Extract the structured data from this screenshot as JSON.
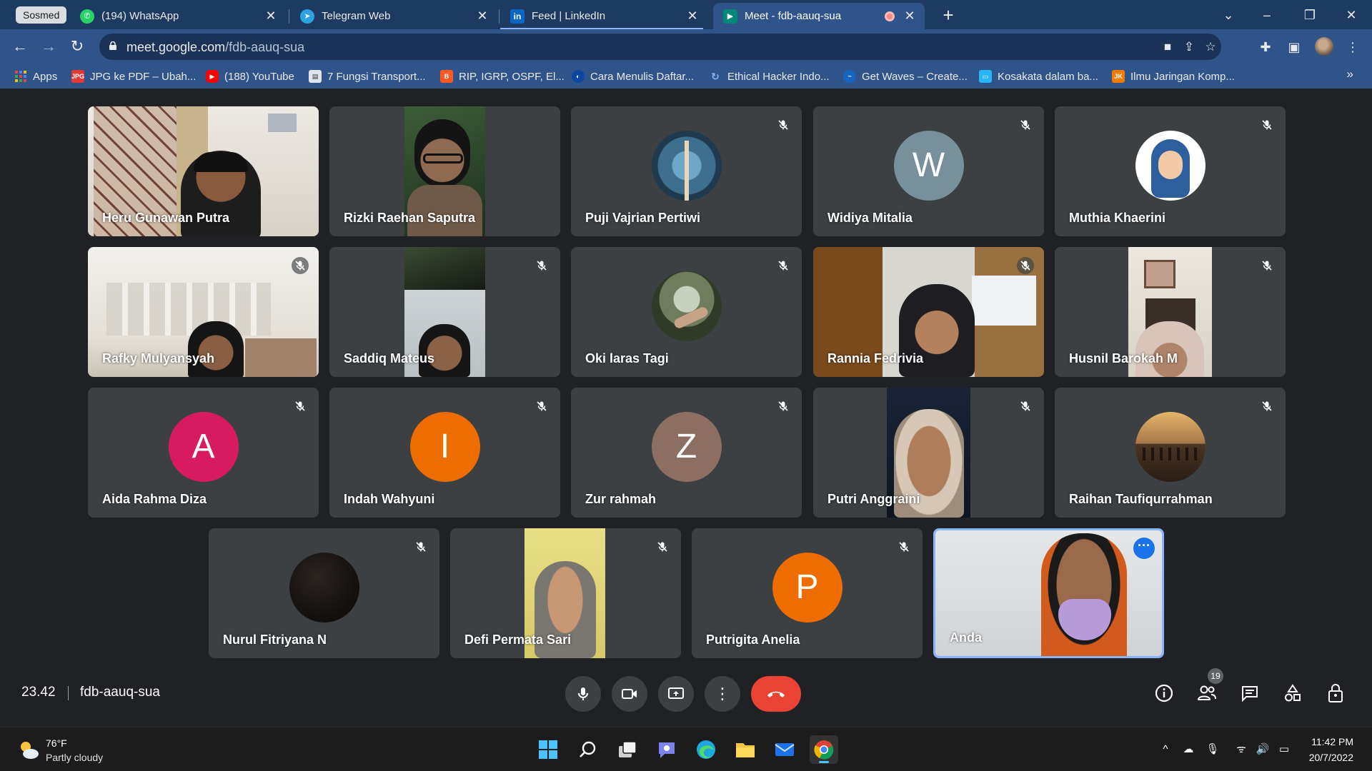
{
  "browser": {
    "tab_group_label": "Sosmed",
    "tabs": [
      {
        "title": "(194) WhatsApp",
        "favicon": "whatsapp-icon",
        "favicon_badge": "194"
      },
      {
        "title": "Telegram Web",
        "favicon": "telegram-icon"
      },
      {
        "title": "Feed | LinkedIn",
        "favicon": "linkedin-icon"
      },
      {
        "title": "Meet - fdb-aauq-sua",
        "favicon": "google-meet-icon",
        "active": true,
        "recording": true
      }
    ],
    "url_host": "meet.google.com",
    "url_path": "/fdb-aauq-sua",
    "bookmarks": [
      {
        "label": "Apps",
        "icon": "apps-grid-icon"
      },
      {
        "label": "JPG ke PDF – Ubah...",
        "icon": "jpg-pdf-icon"
      },
      {
        "label": "(188) YouTube",
        "icon": "youtube-icon"
      },
      {
        "label": "7 Fungsi Transport...",
        "icon": "page-icon"
      },
      {
        "label": "RIP, IGRP, OSPF, El...",
        "icon": "blogger-icon"
      },
      {
        "label": "Cara Menulis Daftar...",
        "icon": "globe-icon"
      },
      {
        "label": "Ethical Hacker Indo...",
        "icon": "link-icon"
      },
      {
        "label": "Get Waves – Create...",
        "icon": "waves-icon"
      },
      {
        "label": "Kosakata dalam ba...",
        "icon": "chat-icon"
      },
      {
        "label": "Ilmu Jaringan Komp...",
        "icon": "blog-icon"
      }
    ]
  },
  "meeting": {
    "time": "23.42",
    "code": "fdb-aauq-sua",
    "participant_count": "19",
    "participants": [
      {
        "name": "Heru Gunawan Putra",
        "type": "video",
        "muted": false
      },
      {
        "name": "Rizki Raehan Saputra",
        "type": "video",
        "muted": false
      },
      {
        "name": "Puji Vajrian Pertiwi",
        "type": "photo",
        "muted": true
      },
      {
        "name": "Widiya Mitalia",
        "type": "letter",
        "letter": "W",
        "color": "#78909c",
        "muted": true
      },
      {
        "name": "Muthia Khaerini",
        "type": "photo",
        "muted": true
      },
      {
        "name": "Rafky Mulyansyah",
        "type": "video",
        "muted": true
      },
      {
        "name": "Saddiq Mateus",
        "type": "video",
        "muted": true
      },
      {
        "name": "Oki laras Tagi",
        "type": "photo",
        "muted": true
      },
      {
        "name": "Rannia Fedrivia",
        "type": "video",
        "muted": true
      },
      {
        "name": "Husnil Barokah M",
        "type": "video",
        "muted": true
      },
      {
        "name": "Aida Rahma Diza",
        "type": "letter",
        "letter": "A",
        "color": "#d81b60",
        "muted": true
      },
      {
        "name": "Indah Wahyuni",
        "type": "letter",
        "letter": "I",
        "color": "#ef6c00",
        "muted": true
      },
      {
        "name": "Zur rahmah",
        "type": "letter",
        "letter": "Z",
        "color": "#8d6e63",
        "muted": true
      },
      {
        "name": "Putri Anggraini",
        "type": "video",
        "muted": true
      },
      {
        "name": "Raihan Taufiqurrahman",
        "type": "photo",
        "muted": true
      },
      {
        "name": "Nurul Fitriyana N",
        "type": "photo",
        "muted": true
      },
      {
        "name": "Defi Permata Sari",
        "type": "video",
        "muted": true
      },
      {
        "name": "Putrigita Anelia",
        "type": "letter",
        "letter": "P",
        "color": "#ef6c00",
        "muted": true
      },
      {
        "name": "Anda",
        "type": "video",
        "muted": false,
        "self": true
      }
    ]
  },
  "taskbar": {
    "weather_temp": "76°F",
    "weather_desc": "Partly cloudy",
    "time": "11:42 PM",
    "date": "20/7/2022"
  },
  "colors": {
    "tab_strip": "#1d3a63",
    "toolbar": "#2f5489",
    "meet_bg": "#202124",
    "tile_bg": "#3c4043",
    "hangup": "#ea4335",
    "self_border": "#8ab4f8"
  }
}
